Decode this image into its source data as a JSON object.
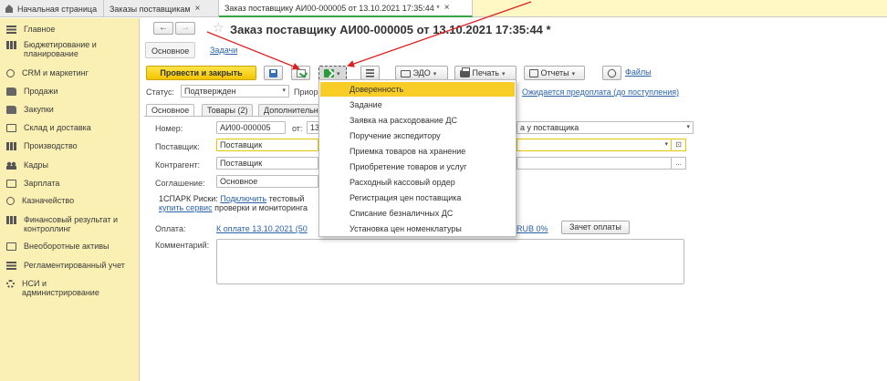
{
  "tabs": [
    {
      "label": "Начальная страница"
    },
    {
      "label": "Заказы поставщикам",
      "close": "×"
    },
    {
      "label": "Заказ поставщику АИ00-000005 от 13.10.2021 17:35:44 *",
      "close": "×"
    }
  ],
  "sidebar": {
    "items": [
      {
        "label": "Главное",
        "icon": "menu-icon"
      },
      {
        "label": "Бюджетирование и планирование",
        "icon": "budget-icon"
      },
      {
        "label": "CRM и маркетинг",
        "icon": "crm-icon"
      },
      {
        "label": "Продажи",
        "icon": "sales-icon"
      },
      {
        "label": "Закупки",
        "icon": "purchases-icon"
      },
      {
        "label": "Склад и доставка",
        "icon": "warehouse-icon"
      },
      {
        "label": "Производство",
        "icon": "production-icon"
      },
      {
        "label": "Кадры",
        "icon": "staff-icon"
      },
      {
        "label": "Зарплата",
        "icon": "salary-icon"
      },
      {
        "label": "Казначейство",
        "icon": "treasury-icon"
      },
      {
        "label": "Финансовый результат и контроллинг",
        "icon": "finance-icon"
      },
      {
        "label": "Внеоборотные активы",
        "icon": "assets-icon"
      },
      {
        "label": "Регламентированный учет",
        "icon": "accounting-icon"
      },
      {
        "label": "НСИ и администрирование",
        "icon": "settings-icon"
      }
    ]
  },
  "nav": {
    "back": "←",
    "forward": "→",
    "star": "☆"
  },
  "header": {
    "title": "Заказ поставщику АИ00-000005 от 13.10.2021 17:35:44 *"
  },
  "subtabs": {
    "main": "Основное",
    "tasks": "Задачи"
  },
  "toolbar": {
    "post_close": "Провести и закрыть",
    "edo": "ЭДО",
    "print": "Печать",
    "reports": "Отчеты",
    "files": "Файлы",
    "caret": "▾"
  },
  "status": {
    "label": "Статус:",
    "value": "Подтвержден",
    "priority_label": "Приор",
    "payment_link": "Ожидается предоплата (до поступления)"
  },
  "form_tabs": {
    "main": "Основное",
    "goods": "Товары (2)",
    "extra": "Дополнительн"
  },
  "form": {
    "number_label": "Номер:",
    "number_value": "АИ00-000005",
    "date_label": "от:",
    "date_value": "13",
    "op_value": "а у поставщика",
    "supplier_label": "Поставщик:",
    "supplier_value": "Поставщик",
    "contractor_label": "Контрагент:",
    "contractor_value": "Поставщик",
    "agreement_label": "Соглашение:",
    "agreement_value": "Основное",
    "open_btn": "⊡",
    "select_btn": "...",
    "spark_text_1": "1СПАРК Риски: ",
    "spark_link_1": "Подключить",
    "spark_text_2": " тестовый",
    "spark_link_2": "купить сервис",
    "spark_text_3": " проверки и мониторинга",
    "payment_label": "Оплата:",
    "payment_link": "К оплате 13.10.2021 (50",
    "payment_rub": "RUB 0%",
    "payment_btn": "Зачет оплаты",
    "comment_label": "Комментарий:"
  },
  "dropdown": {
    "items": [
      "Доверенность",
      "Задание",
      "Заявка на расходование ДС",
      "Поручение экспедитору",
      "Приемка товаров на хранение",
      "Приобретение товаров и услуг",
      "Расходный кассовый ордер",
      "Регистрация цен поставщика",
      "Списание безналичных ДС",
      "Установка цен номенклатуры"
    ],
    "selected_index": 0
  },
  "colors": {
    "accent": "#f8cd25",
    "sidebar": "#fbf0b4",
    "link": "#2a62a8",
    "annotation": "#e02020"
  }
}
